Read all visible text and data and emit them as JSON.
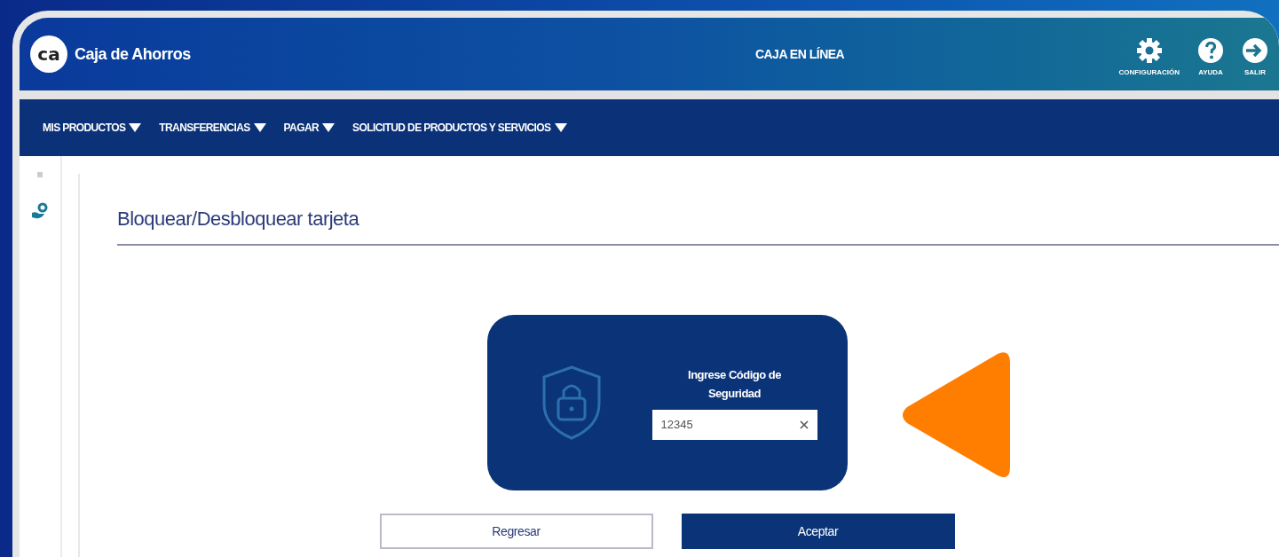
{
  "header": {
    "brand_logo": "ca",
    "brand_name": "Caja de Ahorros",
    "title": "CAJA EN LÍNEA",
    "actions": [
      {
        "kind": "settings",
        "label": "CONFIGURACIÓN"
      },
      {
        "kind": "help",
        "label": "AYUDA"
      },
      {
        "kind": "logout",
        "label": "SALIR"
      }
    ]
  },
  "nav": {
    "items": [
      {
        "label": "MIS PRODUCTOS"
      },
      {
        "label": "TRANSFERENCIAS"
      },
      {
        "label": "PAGAR"
      },
      {
        "label": "SOLICITUD DE PRODUCTOS Y SERVICIOS"
      }
    ]
  },
  "page": {
    "title": "Bloquear/Desbloquear tarjeta",
    "security_card": {
      "label": "Ingrese Código de Seguridad",
      "value": "12345"
    },
    "buttons": [
      {
        "kind": "secondary",
        "label": "Regresar"
      },
      {
        "kind": "primary",
        "label": "Aceptar"
      }
    ]
  }
}
